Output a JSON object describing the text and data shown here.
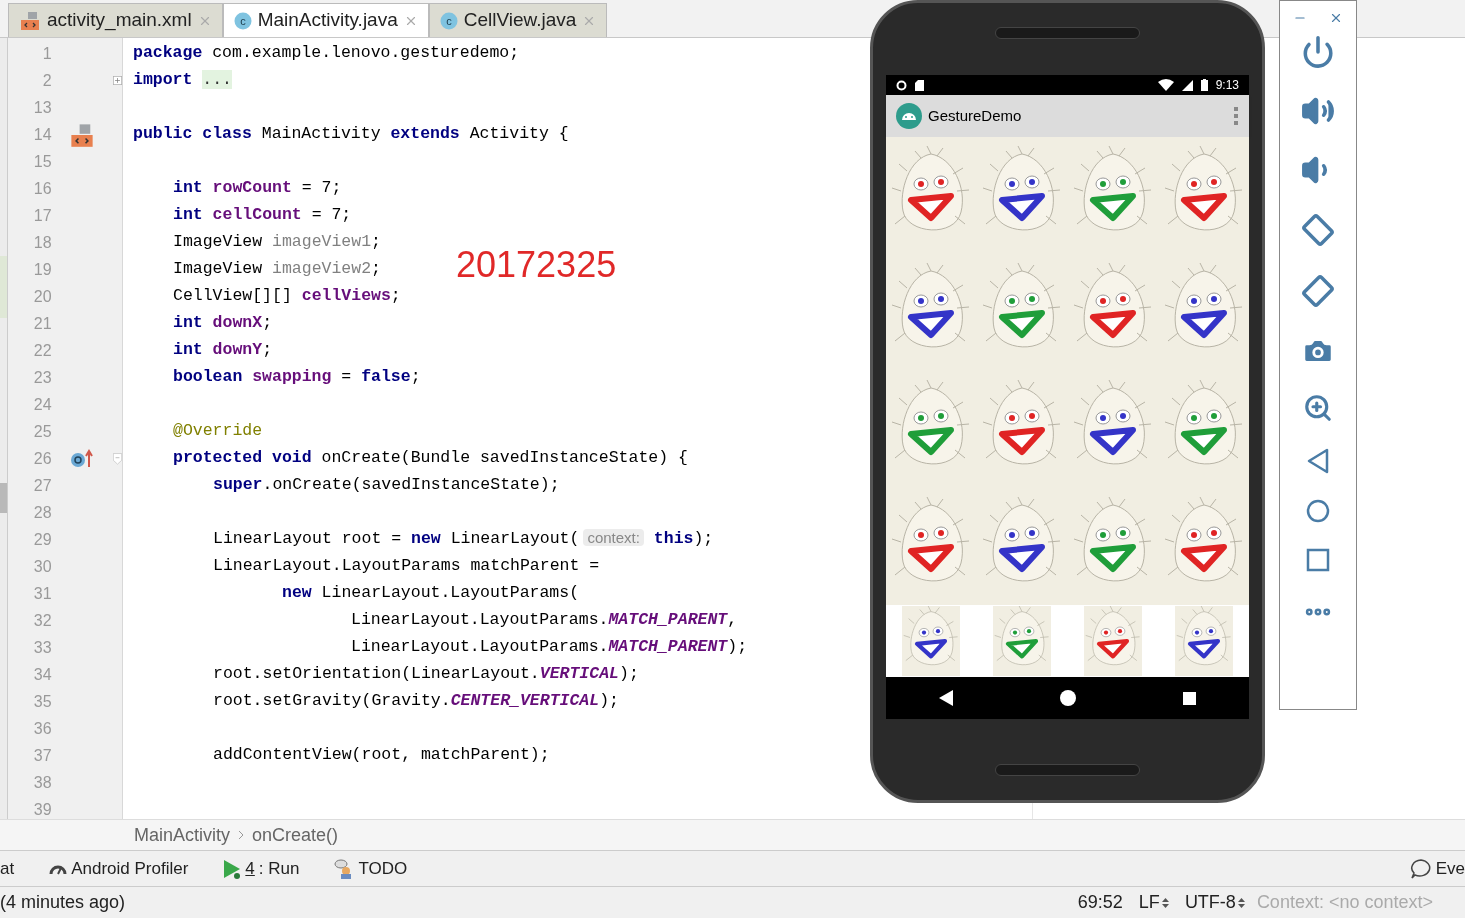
{
  "tabs": [
    {
      "label": "activity_main.xml",
      "kind": "layout",
      "selected": false
    },
    {
      "label": "MainActivity.java",
      "kind": "class",
      "icon_letter": "c",
      "selected": true
    },
    {
      "label": "CellView.java",
      "kind": "class",
      "icon_letter": "c",
      "selected": false
    }
  ],
  "editor": {
    "lines": [
      {
        "number": "1",
        "segments": [
          {
            "kind": "kw",
            "text": "package"
          },
          {
            "kind": "plain",
            "text": " com.example.lenovo.gesturedemo;"
          }
        ]
      },
      {
        "number": "2",
        "fold": {
          "kind": "expand"
        },
        "segments": [
          {
            "kind": "kw",
            "text": "import "
          },
          {
            "kind": "folded",
            "text": "..."
          }
        ]
      },
      {
        "number": "13"
      },
      {
        "number": "14",
        "gutter": {
          "kind": "layout"
        },
        "segments": [
          {
            "kind": "kw",
            "text": "public class"
          },
          {
            "kind": "plain",
            "text": " MainActivity "
          },
          {
            "kind": "kw",
            "text": "extends"
          },
          {
            "kind": "plain",
            "text": " Activity {"
          }
        ],
        "children": [
          {
            "number": "15"
          },
          {
            "number": "16",
            "segments": [
              {
                "kind": "kw",
                "text": "int"
              },
              {
                "kind": "field",
                "text": " rowCount"
              },
              {
                "kind": "plain",
                "text": " = 7;"
              }
            ]
          },
          {
            "number": "17",
            "segments": [
              {
                "kind": "kw",
                "text": "int"
              },
              {
                "kind": "field",
                "text": " cellCount"
              },
              {
                "kind": "plain",
                "text": " = 7;"
              }
            ]
          },
          {
            "number": "18",
            "segments": [
              {
                "kind": "plain",
                "text": "ImageView "
              },
              {
                "kind": "unused",
                "text": "imageView1"
              },
              {
                "kind": "plain",
                "text": ";"
              }
            ]
          },
          {
            "number": "19",
            "segments": [
              {
                "kind": "plain",
                "text": "ImageView "
              },
              {
                "kind": "unused",
                "text": "imageView2"
              },
              {
                "kind": "plain",
                "text": ";"
              }
            ]
          },
          {
            "number": "20",
            "segments": [
              {
                "kind": "plain",
                "text": "CellView[][] "
              },
              {
                "kind": "field",
                "text": "cellViews"
              },
              {
                "kind": "plain",
                "text": ";"
              }
            ]
          },
          {
            "number": "21",
            "segments": [
              {
                "kind": "kw",
                "text": "int"
              },
              {
                "kind": "field",
                "text": " downX"
              },
              {
                "kind": "plain",
                "text": ";"
              }
            ]
          },
          {
            "number": "22",
            "segments": [
              {
                "kind": "kw",
                "text": "int"
              },
              {
                "kind": "field",
                "text": " downY"
              },
              {
                "kind": "plain",
                "text": ";"
              }
            ]
          },
          {
            "number": "23",
            "segments": [
              {
                "kind": "kw",
                "text": "boolean"
              },
              {
                "kind": "field",
                "text": " swapping"
              },
              {
                "kind": "plain",
                "text": " = "
              },
              {
                "kind": "kw",
                "text": "false"
              },
              {
                "kind": "plain",
                "text": ";"
              }
            ]
          },
          {
            "number": "24"
          },
          {
            "number": "25",
            "segments": [
              {
                "kind": "annotation",
                "text": "@Override"
              }
            ]
          },
          {
            "number": "26",
            "gutter": {
              "kind": "override"
            },
            "fold": {
              "kind": "collapse"
            },
            "segments": [
              {
                "kind": "kw",
                "text": "protected void"
              },
              {
                "kind": "plain",
                "text": " onCreate(Bundle savedInstanceState) {"
              }
            ],
            "children": [
              {
                "number": "27",
                "segments": [
                  {
                    "kind": "kw",
                    "text": "super"
                  },
                  {
                    "kind": "plain",
                    "text": ".onCreate(savedInstanceState);"
                  }
                ]
              },
              {
                "number": "28"
              },
              {
                "number": "29",
                "segments": [
                  {
                    "kind": "plain",
                    "text": "LinearLayout root = "
                  },
                  {
                    "kind": "kw",
                    "text": "new"
                  },
                  {
                    "kind": "plain",
                    "text": " LinearLayout("
                  },
                  {
                    "kind": "hint",
                    "text": "context:"
                  },
                  {
                    "kind": "kw",
                    "text": " this"
                  },
                  {
                    "kind": "plain",
                    "text": ");"
                  }
                ]
              },
              {
                "number": "30",
                "segments": [
                  {
                    "kind": "plain",
                    "text": "LinearLayout.LayoutParams matchParent ="
                  }
                ],
                "children": [
                  {
                    "number": "31",
                    "segments": [
                      {
                        "kind": "kw",
                        "text": "new"
                      },
                      {
                        "kind": "plain",
                        "text": " LinearLayout.LayoutParams("
                      }
                    ],
                    "children": [
                      {
                        "number": "32",
                        "segments": [
                          {
                            "kind": "plain",
                            "text": "LinearLayout.LayoutParams."
                          },
                          {
                            "kind": "const",
                            "text": "MATCH_PARENT"
                          },
                          {
                            "kind": "plain",
                            "text": ","
                          }
                        ]
                      },
                      {
                        "number": "33",
                        "segments": [
                          {
                            "kind": "plain",
                            "text": "LinearLayout.LayoutParams."
                          },
                          {
                            "kind": "const",
                            "text": "MATCH_PARENT"
                          },
                          {
                            "kind": "plain",
                            "text": ");"
                          }
                        ]
                      }
                    ]
                  }
                ]
              },
              {
                "number": "34",
                "segments": [
                  {
                    "kind": "plain",
                    "text": "root.setOrientation(LinearLayout."
                  },
                  {
                    "kind": "const",
                    "text": "VERTICAL"
                  },
                  {
                    "kind": "plain",
                    "text": ");"
                  }
                ]
              },
              {
                "number": "35",
                "segments": [
                  {
                    "kind": "plain",
                    "text": "root.setGravity(Gravity."
                  },
                  {
                    "kind": "const",
                    "text": "CENTER_VERTICAL"
                  },
                  {
                    "kind": "plain",
                    "text": ");"
                  }
                ]
              },
              {
                "number": "36"
              },
              {
                "number": "37",
                "segments": [
                  {
                    "kind": "plain",
                    "text": "addContentView(root, matchParent);"
                  }
                ]
              },
              {
                "number": "38"
              },
              {
                "number": "39"
              }
            ]
          }
        ]
      }
    ],
    "overlay_label": "20172325"
  },
  "breadcrumb": [
    "MainActivity",
    "onCreate()"
  ],
  "tool_windows": [
    {
      "kind": "plain",
      "label": "at"
    },
    {
      "kind": "profiler",
      "label": "Android Profiler"
    },
    {
      "kind": "run",
      "mnemonic": "4",
      "label": ": Run"
    },
    {
      "kind": "todo",
      "label": "TODO"
    }
  ],
  "tool_windows_right": {
    "label": "Eve"
  },
  "status_bar": {
    "message": "(4 minutes ago)",
    "position": "69:52",
    "line_separator": "LF",
    "encoding": "UTF-8",
    "context": "Context: <no context>"
  },
  "phone": {
    "time": "9:13",
    "app_title": "GestureDemo",
    "grid": [
      {
        "kind": "full",
        "cells": [
          {
            "color": "#e02424"
          },
          {
            "color": "#3434c8"
          },
          {
            "color": "#1f9e3a"
          },
          {
            "color": "#e02424"
          }
        ]
      },
      {
        "kind": "full",
        "cells": [
          {
            "color": "#3434c8"
          },
          {
            "color": "#1f9e3a"
          },
          {
            "color": "#e02424"
          },
          {
            "color": "#3434c8"
          }
        ]
      },
      {
        "kind": "full",
        "cells": [
          {
            "color": "#1f9e3a"
          },
          {
            "color": "#e02424"
          },
          {
            "color": "#3434c8"
          },
          {
            "color": "#1f9e3a"
          }
        ]
      },
      {
        "kind": "full",
        "cells": [
          {
            "color": "#e02424"
          },
          {
            "color": "#3434c8"
          },
          {
            "color": "#1f9e3a"
          },
          {
            "color": "#e02424"
          }
        ]
      },
      {
        "kind": "small",
        "cells": [
          {
            "color": "#3434c8"
          },
          {
            "color": "#1f9e3a"
          },
          {
            "color": "#e02424"
          },
          {
            "color": "#3434c8"
          }
        ]
      }
    ]
  }
}
